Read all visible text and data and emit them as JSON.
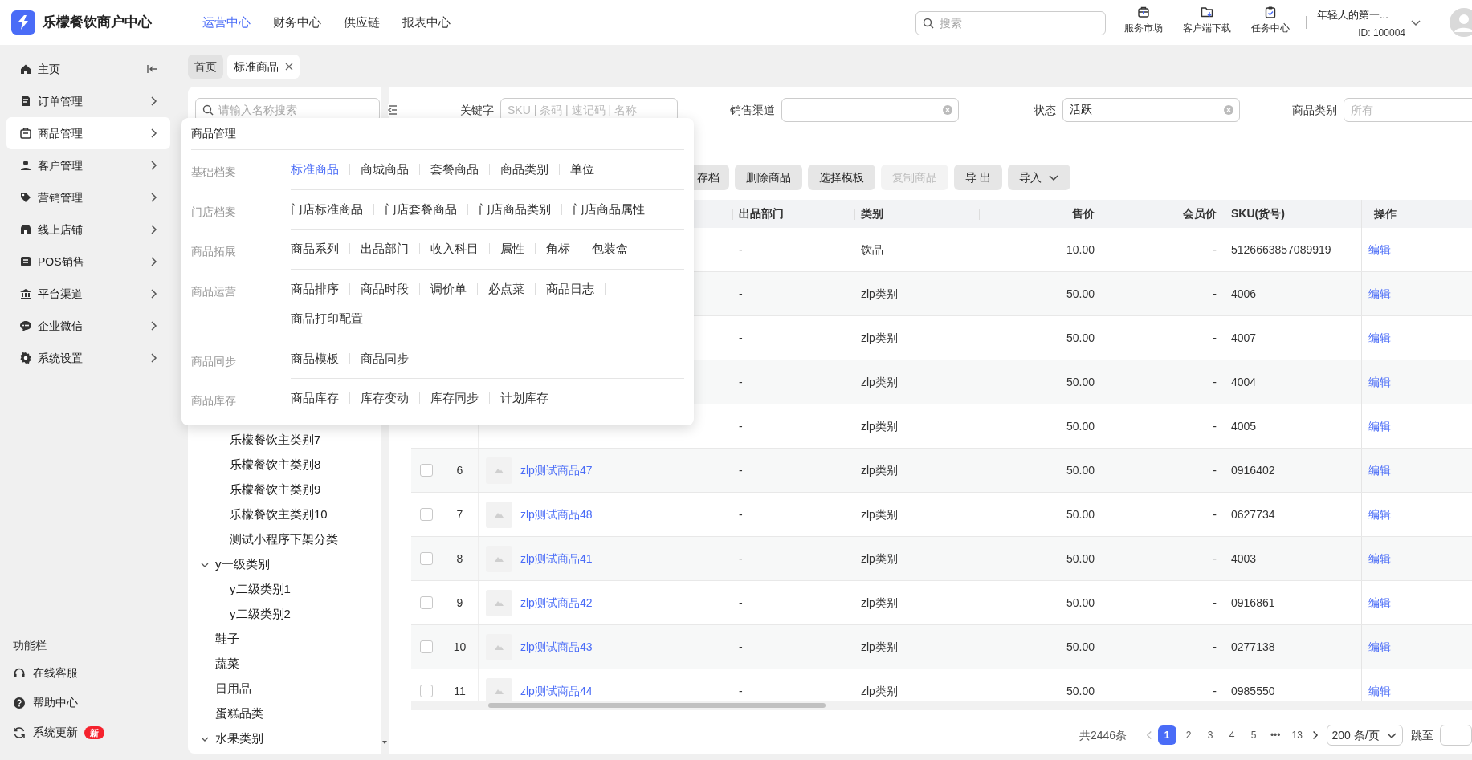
{
  "app": {
    "name": "乐檬餐饮商户中心"
  },
  "top_nav": [
    {
      "label": "运营中心",
      "selected": true
    },
    {
      "label": "财务中心",
      "selected": false
    },
    {
      "label": "供应链",
      "selected": false
    },
    {
      "label": "报表中心",
      "selected": false
    }
  ],
  "search": {
    "placeholder": "搜索"
  },
  "header_tools": [
    {
      "label": "服务市场"
    },
    {
      "label": "客户端下载"
    },
    {
      "label": "任务中心"
    }
  ],
  "account": {
    "name": "年轻人的第一...",
    "id": "ID: 100004"
  },
  "sidebar": {
    "items": [
      {
        "label": "主页",
        "kind": "link",
        "selected": false
      },
      {
        "label": "订单管理",
        "kind": "menu",
        "selected": false
      },
      {
        "label": "商品管理",
        "kind": "menu",
        "selected": true
      },
      {
        "label": "客户管理",
        "kind": "menu",
        "selected": false
      },
      {
        "label": "营销管理",
        "kind": "menu",
        "selected": false
      },
      {
        "label": "线上店铺",
        "kind": "menu",
        "selected": false
      },
      {
        "label": "POS销售",
        "kind": "menu",
        "selected": false
      },
      {
        "label": "平台渠道",
        "kind": "menu",
        "selected": false
      },
      {
        "label": "企业微信",
        "kind": "menu",
        "selected": false
      },
      {
        "label": "系统设置",
        "kind": "menu",
        "selected": false
      }
    ],
    "footer_title": "功能栏",
    "footer_items": [
      {
        "label": "在线客服"
      },
      {
        "label": "帮助中心"
      },
      {
        "label": "系统更新",
        "badge": "新"
      }
    ]
  },
  "tabs": [
    {
      "label": "首页",
      "selected": false,
      "closable": false
    },
    {
      "label": "标准商品",
      "selected": true,
      "closable": true
    }
  ],
  "tree": {
    "search_placeholder": "请输入名称搜索",
    "nodes": [
      {
        "children": [
          {
            "label": "乐檬餐饮主类别7"
          },
          {
            "label": "乐檬餐饮主类别8"
          },
          {
            "label": "乐檬餐饮主类别9"
          },
          {
            "label": "乐檬餐饮主类别10"
          },
          {
            "label": "测试小程序下架分类"
          }
        ]
      },
      {
        "label": "y一级类别",
        "expanded": true,
        "children": [
          {
            "label": "y二级类别1"
          },
          {
            "label": "y二级类别2"
          }
        ]
      },
      {
        "label": "鞋子"
      },
      {
        "label": "蔬菜"
      },
      {
        "label": "日用品"
      },
      {
        "label": "蛋糕品类"
      },
      {
        "label": "水果类别",
        "expanded": true
      }
    ]
  },
  "filters": [
    {
      "label": "关键字",
      "placeholder": "SKU | 条码 | 速记码 | 名称",
      "clearable": false
    },
    {
      "label": "销售渠道",
      "clearable": true
    },
    {
      "label": "状态",
      "value": "活跃",
      "clearable": true
    },
    {
      "label": "商品类别",
      "placeholder": "所有",
      "clearable": false
    }
  ],
  "toolbar": [
    {
      "label": "存档",
      "disabled": false,
      "dropdown": false
    },
    {
      "label": "删除商品",
      "disabled": false,
      "dropdown": false
    },
    {
      "label": "选择模板",
      "disabled": false,
      "dropdown": false
    },
    {
      "label": "复制商品",
      "disabled": true,
      "dropdown": false
    },
    {
      "label": "导 出",
      "disabled": false,
      "dropdown": false
    },
    {
      "label": "导入",
      "disabled": false,
      "dropdown": true
    }
  ],
  "table": {
    "columns": [
      {
        "label": "出品部门"
      },
      {
        "label": "类别"
      },
      {
        "label": "售价"
      },
      {
        "label": "会员价"
      },
      {
        "label": "SKU(货号)"
      },
      {
        "label": "操作"
      }
    ],
    "rows": [
      {
        "dept": "-",
        "category": "饮品",
        "price": "10.00",
        "member_price": "-",
        "sku": "5126663857089919",
        "action": "编辑"
      },
      {
        "dept": "-",
        "category": "zlp类别",
        "price": "50.00",
        "member_price": "-",
        "sku": "4006",
        "action": "编辑"
      },
      {
        "dept": "-",
        "category": "zlp类别",
        "price": "50.00",
        "member_price": "-",
        "sku": "4007",
        "action": "编辑"
      },
      {
        "dept": "-",
        "category": "zlp类别",
        "price": "50.00",
        "member_price": "-",
        "sku": "4004",
        "action": "编辑"
      },
      {
        "dept": "-",
        "category": "zlp类别",
        "price": "50.00",
        "member_price": "-",
        "sku": "4005",
        "action": "编辑"
      },
      {
        "checked": false,
        "index": "6",
        "name": "zlp测试商品47",
        "dept": "-",
        "category": "zlp类别",
        "price": "50.00",
        "member_price": "-",
        "sku": "0916402",
        "action": "编辑"
      },
      {
        "checked": false,
        "index": "7",
        "name": "zlp测试商品48",
        "dept": "-",
        "category": "zlp类别",
        "price": "50.00",
        "member_price": "-",
        "sku": "0627734",
        "action": "编辑"
      },
      {
        "checked": false,
        "index": "8",
        "name": "zlp测试商品41",
        "dept": "-",
        "category": "zlp类别",
        "price": "50.00",
        "member_price": "-",
        "sku": "4003",
        "action": "编辑"
      },
      {
        "checked": false,
        "index": "9",
        "name": "zlp测试商品42",
        "dept": "-",
        "category": "zlp类别",
        "price": "50.00",
        "member_price": "-",
        "sku": "0916861",
        "action": "编辑"
      },
      {
        "checked": false,
        "index": "10",
        "name": "zlp测试商品43",
        "dept": "-",
        "category": "zlp类别",
        "price": "50.00",
        "member_price": "-",
        "sku": "0277138",
        "action": "编辑"
      },
      {
        "checked": false,
        "index": "11",
        "name": "zlp测试商品44",
        "dept": "-",
        "category": "zlp类别",
        "price": "50.00",
        "member_price": "-",
        "sku": "0985550",
        "action": "编辑"
      }
    ]
  },
  "pagination": {
    "total": "共2446条",
    "pages": [
      {
        "label": "1",
        "selected": true
      },
      {
        "label": "2",
        "selected": false
      },
      {
        "label": "3",
        "selected": false
      },
      {
        "label": "4",
        "selected": false
      },
      {
        "label": "5",
        "selected": false
      },
      {
        "label": "•••",
        "selected": false
      },
      {
        "label": "13",
        "selected": false
      }
    ],
    "page_size": "200 条/页",
    "jump_label": "跳至"
  },
  "menu_popup": {
    "title": "商品管理",
    "sections": [
      {
        "label": "基础档案",
        "links": [
          {
            "label": "标准商品",
            "selected": true
          },
          {
            "label": "商城商品",
            "selected": false
          },
          {
            "label": "套餐商品",
            "selected": false
          },
          {
            "label": "商品类别",
            "selected": false
          },
          {
            "label": "单位",
            "selected": false
          }
        ]
      },
      {
        "label": "门店档案",
        "links": [
          {
            "label": "门店标准商品",
            "selected": false
          },
          {
            "label": "门店套餐商品",
            "selected": false
          },
          {
            "label": "门店商品类别",
            "selected": false
          },
          {
            "label": "门店商品属性",
            "selected": false
          }
        ]
      },
      {
        "label": "商品拓展",
        "links": [
          {
            "label": "商品系列",
            "selected": false
          },
          {
            "label": "出品部门",
            "selected": false
          },
          {
            "label": "收入科目",
            "selected": false
          },
          {
            "label": "属性",
            "selected": false
          },
          {
            "label": "角标",
            "selected": false
          },
          {
            "label": "包装盒",
            "selected": false
          }
        ]
      },
      {
        "label": "商品运营",
        "links": [
          {
            "label": "商品排序",
            "selected": false
          },
          {
            "label": "商品时段",
            "selected": false
          },
          {
            "label": "调价单",
            "selected": false
          },
          {
            "label": "必点菜",
            "selected": false
          },
          {
            "label": "商品日志",
            "selected": false
          },
          {
            "label": "商品打印配置",
            "selected": false
          }
        ]
      },
      {
        "label": "商品同步",
        "links": [
          {
            "label": "商品模板",
            "selected": false
          },
          {
            "label": "商品同步",
            "selected": false
          }
        ]
      },
      {
        "label": "商品库存",
        "links": [
          {
            "label": "商品库存",
            "selected": false
          },
          {
            "label": "库存变动",
            "selected": false
          },
          {
            "label": "库存同步",
            "selected": false
          },
          {
            "label": "计划库存",
            "selected": false
          }
        ]
      }
    ]
  }
}
